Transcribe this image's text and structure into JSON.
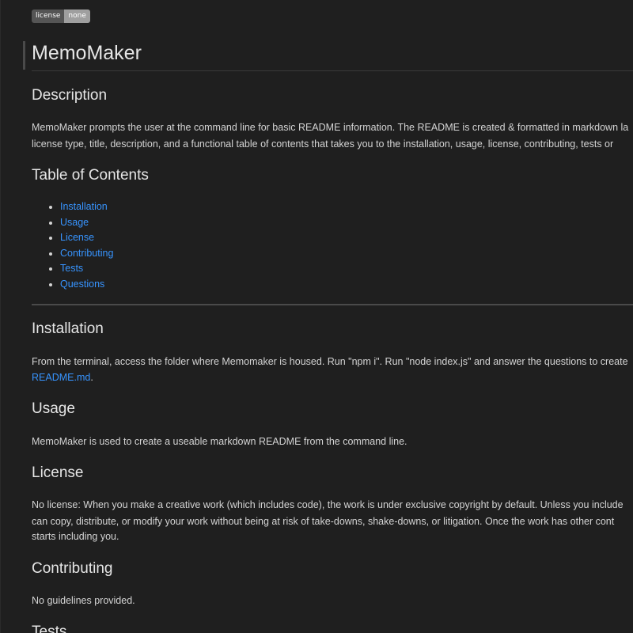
{
  "badge": {
    "label": "license",
    "value": "none"
  },
  "title": "MemoMaker",
  "description": {
    "heading": "Description",
    "line1": "MemoMaker prompts the user at the command line for basic README information. The README is created & formatted in markdown la",
    "line2": "license type, title, description, and a functional table of contents that takes you to the installation, usage, license, contributing, tests or"
  },
  "toc": {
    "heading": "Table of Contents",
    "items": [
      "Installation",
      "Usage",
      "License",
      "Contributing",
      "Tests",
      "Questions"
    ]
  },
  "installation": {
    "heading": "Installation",
    "line1": "From the terminal, access the folder where Memomaker is housed. Run \"npm i\". Run \"node index.js\" and answer the questions to create",
    "link": "README.md",
    "after_link": "."
  },
  "usage": {
    "heading": "Usage",
    "text": "MemoMaker is used to create a useable markdown README from the command line."
  },
  "license": {
    "heading": "License",
    "line1": "No license: When you make a creative work (which includes code), the work is under exclusive copyright by default. Unless you include",
    "line2": "can copy, distribute, or modify your work without being at risk of take-downs, shake-downs, or litigation. Once the work has other cont",
    "line3": "starts including you."
  },
  "contributing": {
    "heading": "Contributing",
    "text": "No guidelines provided."
  },
  "tests": {
    "heading": "Tests"
  },
  "colors": {
    "background": "#1f1f1f",
    "text": "#d4d4d4",
    "heading": "#e6e6e6",
    "link": "#3794ff",
    "badge_label": "#555555",
    "badge_value": "#9f9f9f"
  }
}
